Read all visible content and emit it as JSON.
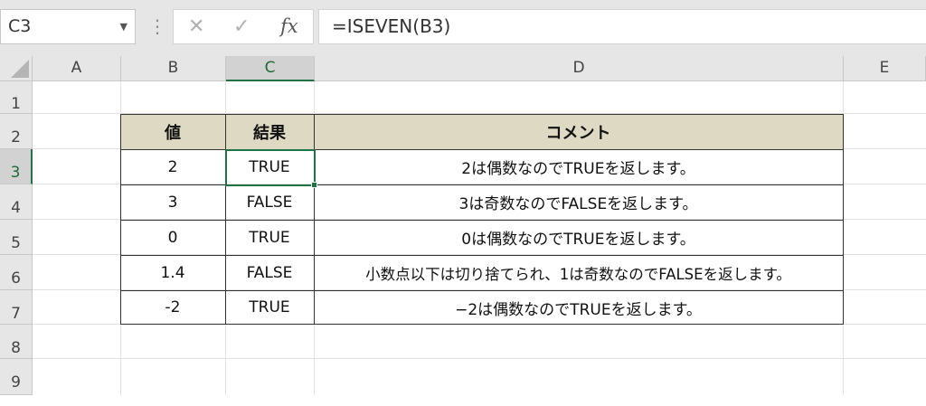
{
  "formula_bar": {
    "name_box": "C3",
    "cancel_symbol": "✕",
    "enter_symbol": "✓",
    "fx_symbol": "fx",
    "formula": "=ISEVEN(B3)"
  },
  "columns": [
    "A",
    "B",
    "C",
    "D",
    "E"
  ],
  "rows": [
    "1",
    "2",
    "3",
    "4",
    "5",
    "6",
    "7",
    "8",
    "9"
  ],
  "selected_cell": "C3",
  "table": {
    "headers": [
      "値",
      "結果",
      "コメント"
    ],
    "rows": [
      {
        "value": "2",
        "result": "TRUE",
        "comment": "2は偶数なのでTRUEを返します。"
      },
      {
        "value": "3",
        "result": "FALSE",
        "comment": "3は奇数なのでFALSEを返します。"
      },
      {
        "value": "0",
        "result": "TRUE",
        "comment": "0は偶数なのでTRUEを返します。"
      },
      {
        "value": "1.4",
        "result": "FALSE",
        "comment": "小数点以下は切り捨てられ、1は奇数なのでFALSEを返します。"
      },
      {
        "value": "-2",
        "result": "TRUE",
        "comment": "−2は偶数なのでTRUEを返します。"
      }
    ]
  },
  "colors": {
    "selection": "#217346",
    "header_fill": "#ddd9c3"
  }
}
